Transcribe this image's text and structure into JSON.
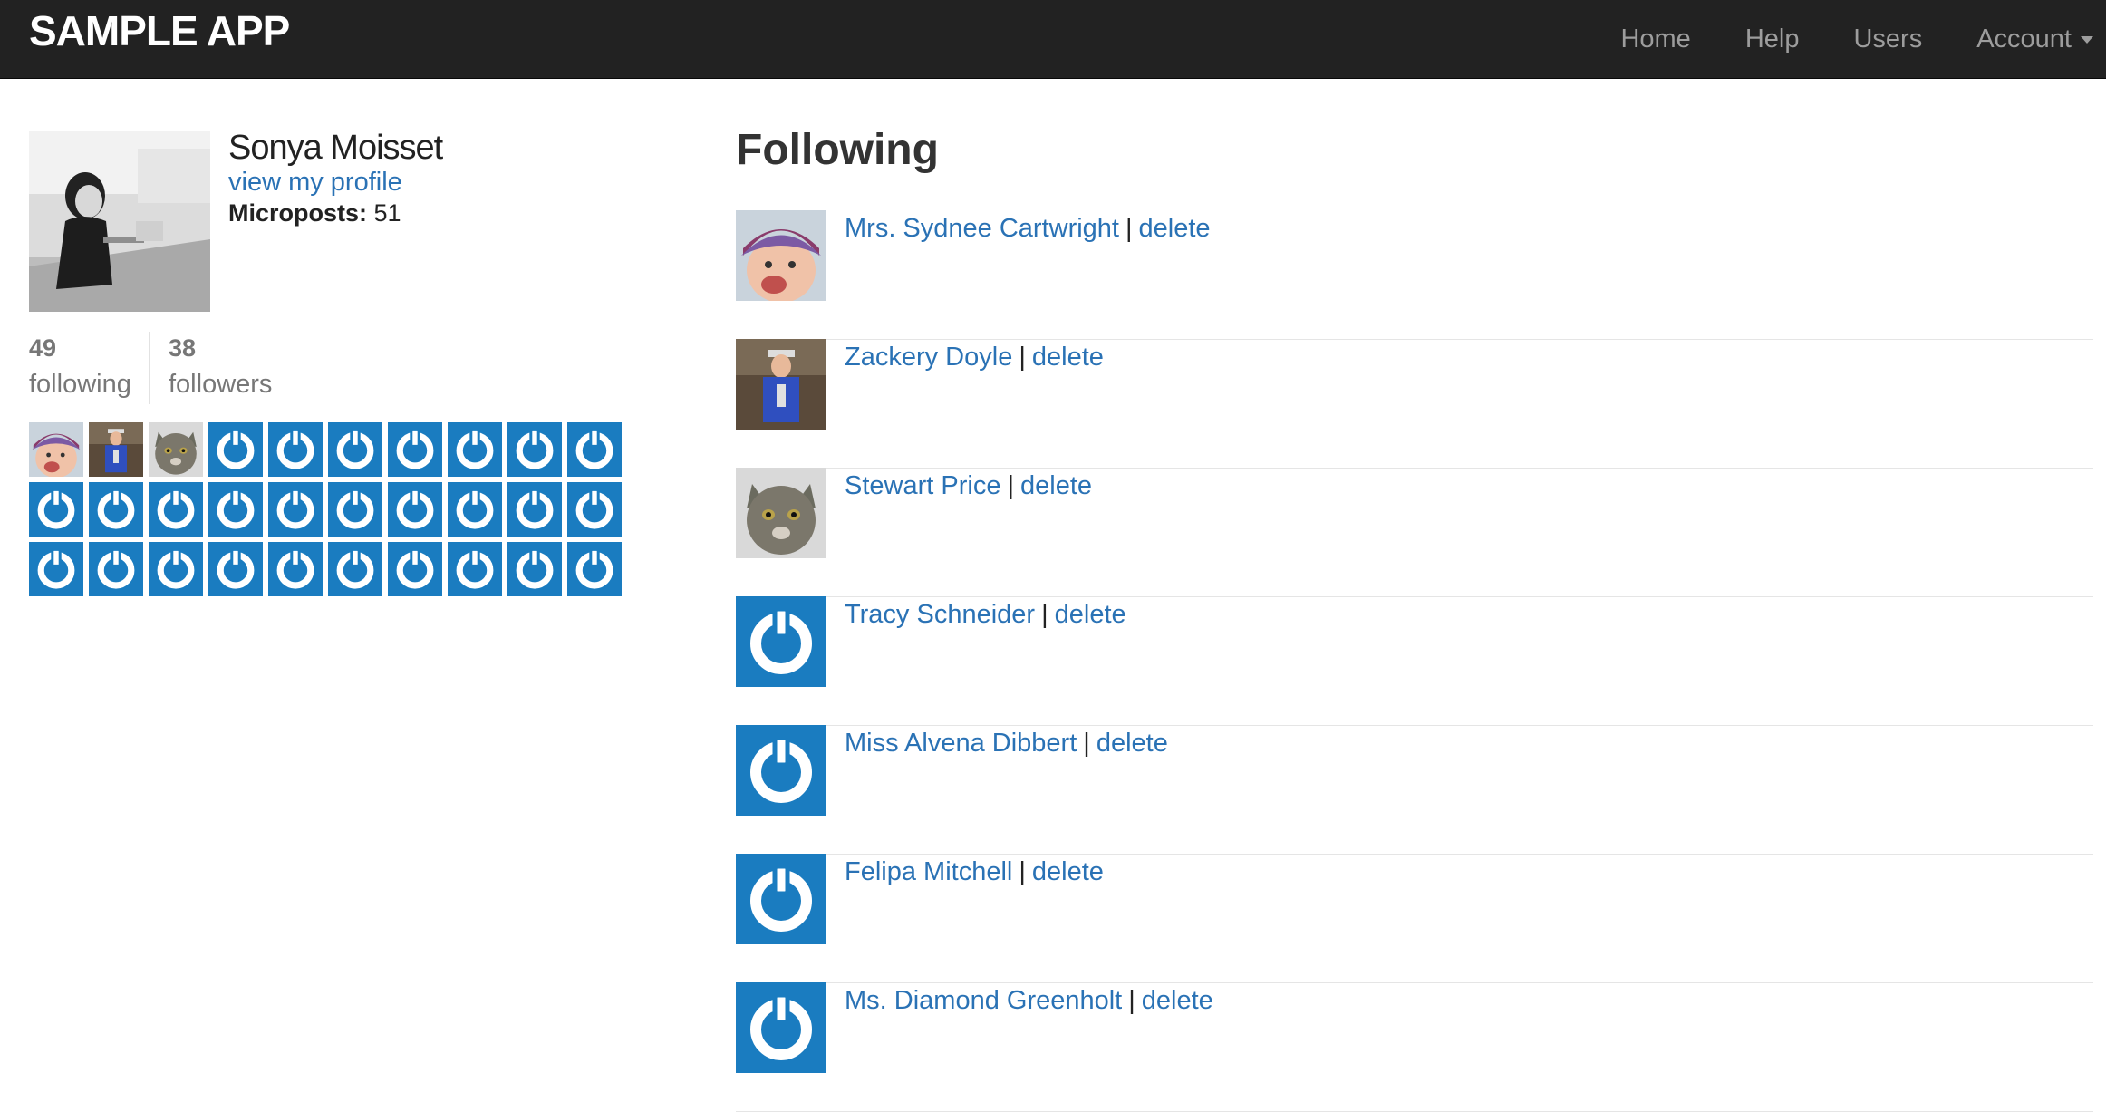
{
  "navbar": {
    "brand": "SAMPLE APP",
    "links": [
      "Home",
      "Help",
      "Users",
      "Account"
    ]
  },
  "profile": {
    "name": "Sonya Moisset",
    "view_profile": "view my profile",
    "microposts_label": "Microposts:",
    "microposts_count": "51",
    "following_count": "49",
    "following_label": "following",
    "followers_count": "38",
    "followers_label": "followers"
  },
  "main": {
    "title": "Following",
    "separator": "|",
    "delete_label": "delete",
    "users": [
      {
        "name": "Mrs. Sydnee Cartwright",
        "avatar": "baby-photo"
      },
      {
        "name": "Zackery Doyle",
        "avatar": "man-photo"
      },
      {
        "name": "Stewart Price",
        "avatar": "cat-photo"
      },
      {
        "name": "Tracy Schneider",
        "avatar": "default-gravatar-icon"
      },
      {
        "name": "Miss Alvena Dibbert",
        "avatar": "default-gravatar-icon"
      },
      {
        "name": "Felipa Mitchell",
        "avatar": "default-gravatar-icon"
      },
      {
        "name": "Ms. Diamond Greenholt",
        "avatar": "default-gravatar-icon"
      }
    ]
  },
  "colors": {
    "navbar_bg": "#222222",
    "link": "#2a72b5",
    "gravatar_blue": "#1a7cc0"
  }
}
